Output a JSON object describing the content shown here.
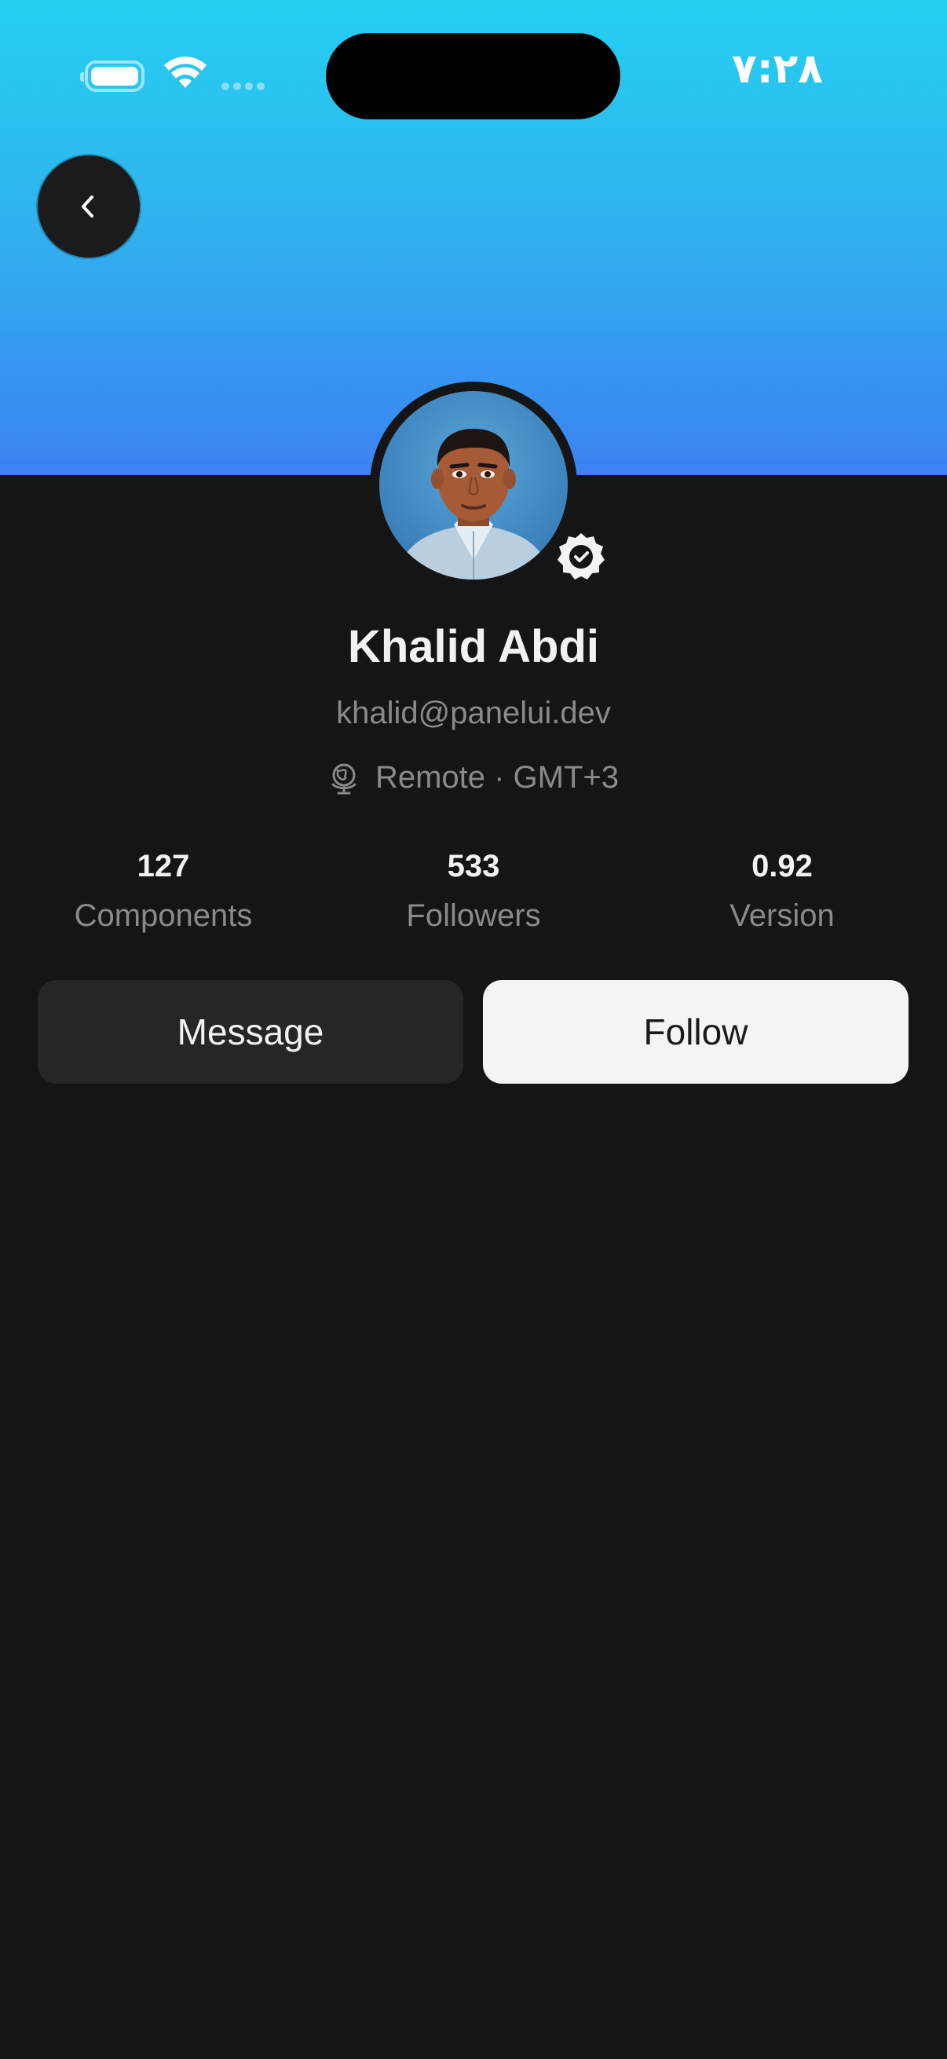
{
  "status_bar": {
    "time": "٧:٢٨"
  },
  "header": {
    "back_icon": "chevron-left-icon",
    "gradient_colors": [
      "#24d0f0",
      "#3b82f2"
    ]
  },
  "profile": {
    "name": "Khalid Abdi",
    "email": "khalid@panelui.dev",
    "location_icon": "globe-icon",
    "location": "Remote · GMT+3",
    "verified_icon": "verified-badge-icon"
  },
  "stats": [
    {
      "value": "127",
      "label": "Components"
    },
    {
      "value": "533",
      "label": "Followers"
    },
    {
      "value": "0.92",
      "label": "Version"
    }
  ],
  "actions": {
    "message_label": "Message",
    "follow_label": "Follow"
  },
  "colors": {
    "background": "#151515",
    "secondary_text": "#8a8a8a",
    "message_button_bg": "#262626",
    "follow_button_bg": "#f4f4f4"
  }
}
